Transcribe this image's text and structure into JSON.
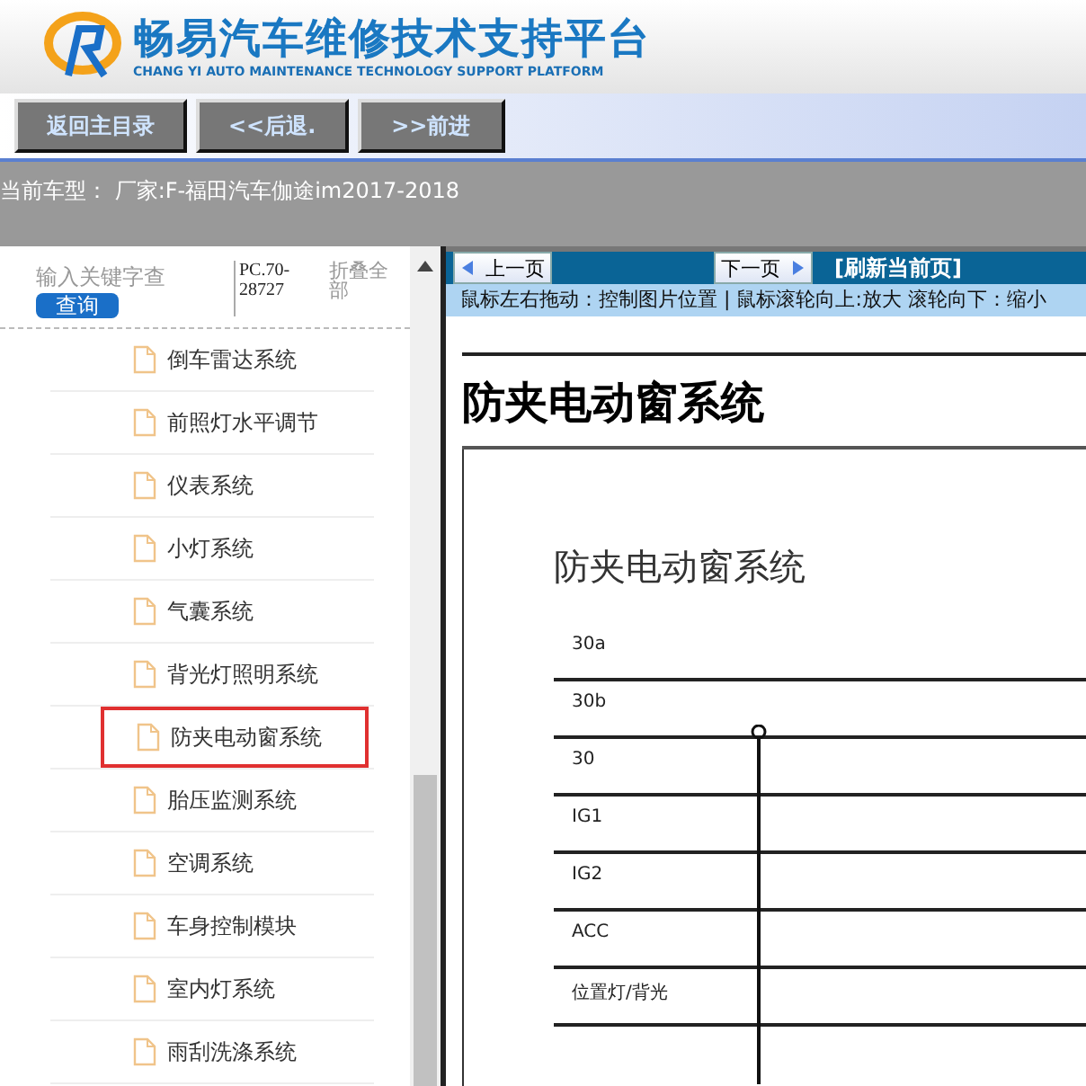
{
  "header": {
    "title": "畅易汽车维修技术支持平台",
    "subtitle": "CHANG YI AUTO MAINTENANCE TECHNOLOGY SUPPORT PLATFORM"
  },
  "nav_buttons": [
    "返回主目录",
    "<<后退.",
    ">>前进"
  ],
  "car_model": "当前车型： 厂家:F-福田汽车伽途im2017-2018",
  "sidebar": {
    "search": {
      "placeholder": "输入关键字查",
      "button": "查询"
    },
    "code": "PC.70-28727",
    "collapse": "折叠全部",
    "items": [
      {
        "label": "倒车雷达系统",
        "selected": false
      },
      {
        "label": "前照灯水平调节",
        "selected": false
      },
      {
        "label": "仪表系统",
        "selected": false
      },
      {
        "label": "小灯系统",
        "selected": false
      },
      {
        "label": "气囊系统",
        "selected": false
      },
      {
        "label": "背光灯照明系统",
        "selected": false
      },
      {
        "label": "防夹电动窗系统",
        "selected": true
      },
      {
        "label": "胎压监测系统",
        "selected": false
      },
      {
        "label": "空调系统",
        "selected": false
      },
      {
        "label": "车身控制模块",
        "selected": false
      },
      {
        "label": "室内灯系统",
        "selected": false
      },
      {
        "label": "雨刮洗涤系统",
        "selected": false
      }
    ]
  },
  "viewer": {
    "prev": "上一页",
    "next": "下一页",
    "refresh": "[刷新当前页]",
    "hint": "鼠标左右拖动：控制图片位置 | 鼠标滚轮向上:放大   滚轮向下：缩小",
    "page_title": "防夹电动窗系统",
    "diagram": {
      "title": "防夹电动窗系统",
      "buses": [
        "30a",
        "30b",
        "30",
        "IG1",
        "IG2",
        "ACC",
        "位置灯/背光"
      ]
    }
  }
}
